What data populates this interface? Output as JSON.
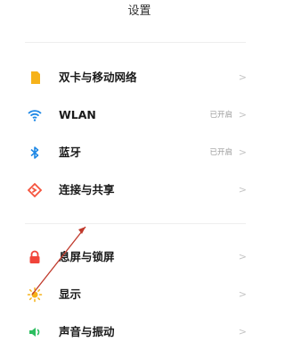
{
  "header": {
    "title": "设置"
  },
  "groups": [
    {
      "items": [
        {
          "label": "双卡与移动网络",
          "status": "",
          "icon": "sim-card-icon",
          "color": "#F6B21A"
        },
        {
          "label": "WLAN",
          "status": "已开启",
          "icon": "wifi-icon",
          "color": "#1E88E5"
        },
        {
          "label": "蓝牙",
          "status": "已开启",
          "icon": "bluetooth-icon",
          "color": "#1E88E5"
        },
        {
          "label": "连接与共享",
          "status": "",
          "icon": "share-connection-icon",
          "color": "#F5533D"
        }
      ]
    },
    {
      "items": [
        {
          "label": "息屏与锁屏",
          "status": "",
          "icon": "lock-icon",
          "color": "#F0443A"
        },
        {
          "label": "显示",
          "status": "",
          "icon": "sun-icon",
          "color": "#F6B21A"
        },
        {
          "label": "声音与振动",
          "status": "",
          "icon": "speaker-icon",
          "color": "#2DBE60"
        }
      ]
    }
  ],
  "chevron": ">",
  "annotation": {
    "type": "red-arrow",
    "color": "#C0392B"
  }
}
